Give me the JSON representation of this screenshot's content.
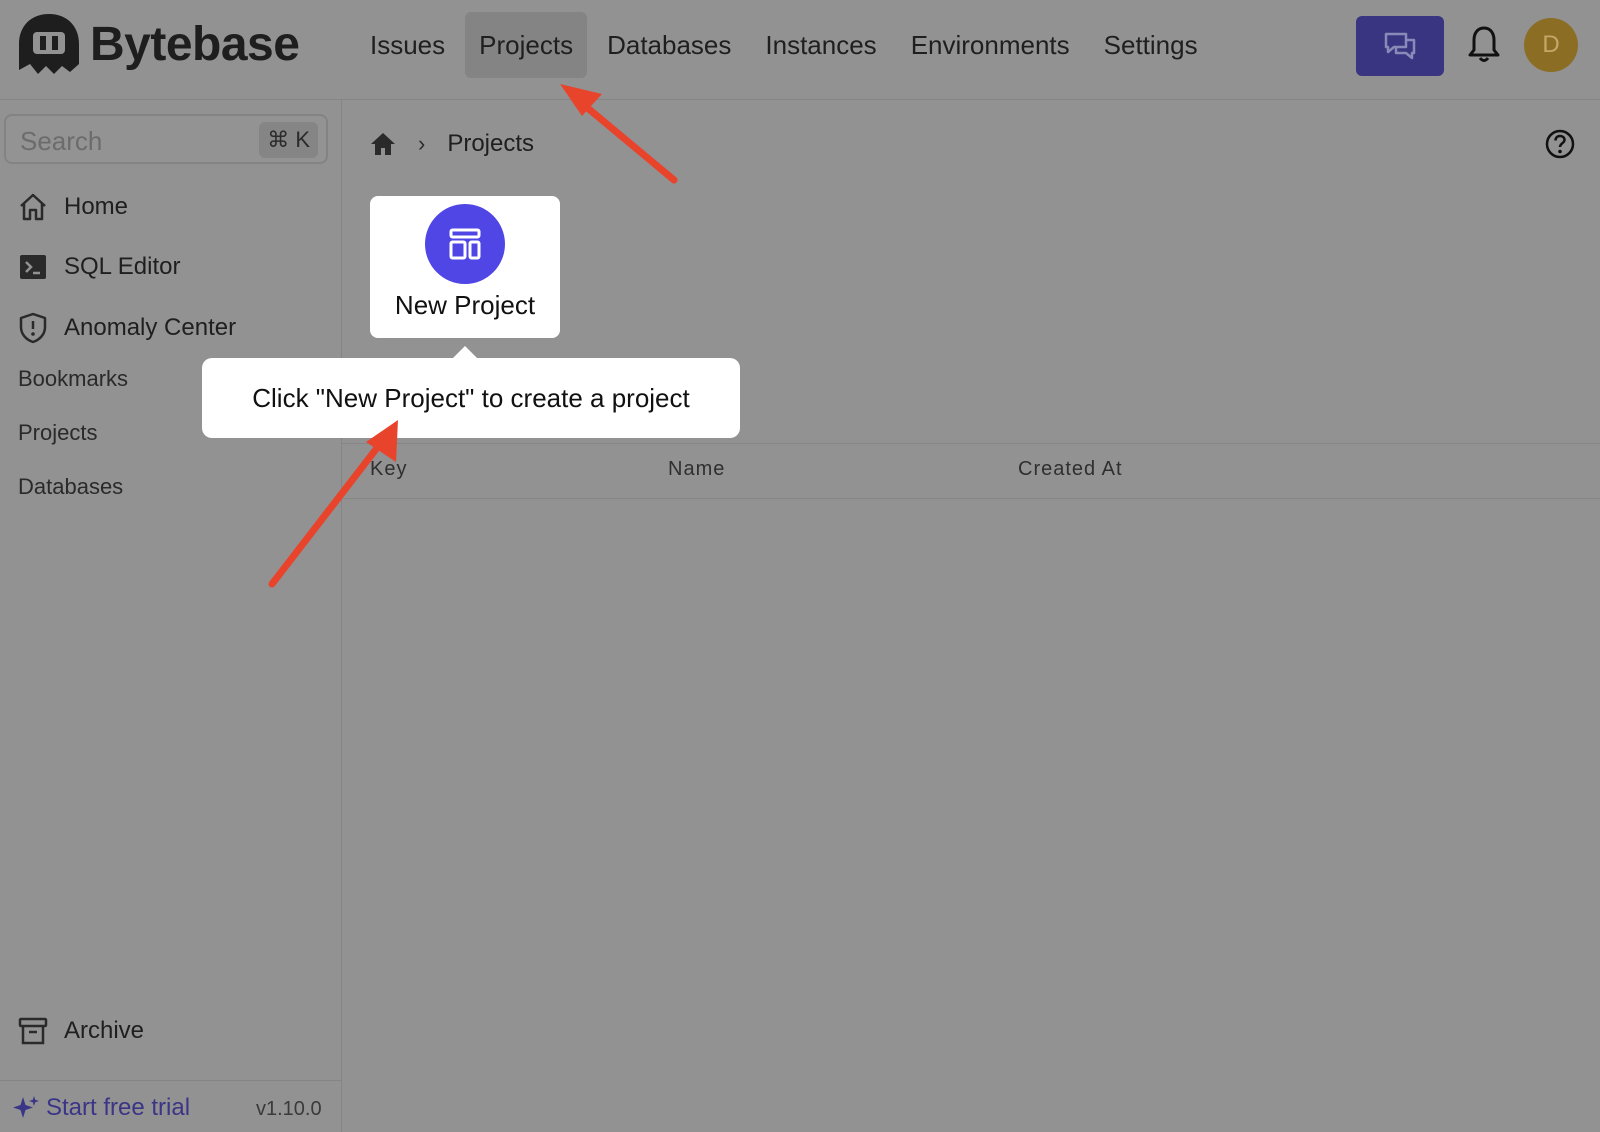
{
  "app": {
    "name": "Bytebase"
  },
  "nav": {
    "items": [
      {
        "label": "Issues",
        "active": false
      },
      {
        "label": "Projects",
        "active": true
      },
      {
        "label": "Databases",
        "active": false
      },
      {
        "label": "Instances",
        "active": false
      },
      {
        "label": "Environments",
        "active": false
      },
      {
        "label": "Settings",
        "active": false
      }
    ]
  },
  "header": {
    "avatar_initial": "D",
    "icons": [
      "chat-icon",
      "bell-icon"
    ]
  },
  "sidebar": {
    "search_placeholder": "Search",
    "search_shortcut": "⌘ K",
    "items": [
      {
        "label": "Home",
        "icon": "home-icon"
      },
      {
        "label": "SQL Editor",
        "icon": "terminal-icon"
      },
      {
        "label": "Anomaly Center",
        "icon": "shield-icon"
      }
    ],
    "sections": [
      "Bookmarks",
      "Projects",
      "Databases"
    ],
    "archive_label": "Archive",
    "trial_label": "Start free trial",
    "version": "v1.10.0"
  },
  "breadcrumb": {
    "current": "Projects"
  },
  "table": {
    "columns": [
      "Key",
      "Name",
      "Created At"
    ]
  },
  "highlight": {
    "button_label": "New Project"
  },
  "tooltip": {
    "text": "Click \"New Project\" to create a project"
  },
  "colors": {
    "accent": "#4f46e5",
    "annotation_arrow": "#e8442c",
    "dim_overlay": "#929292"
  }
}
